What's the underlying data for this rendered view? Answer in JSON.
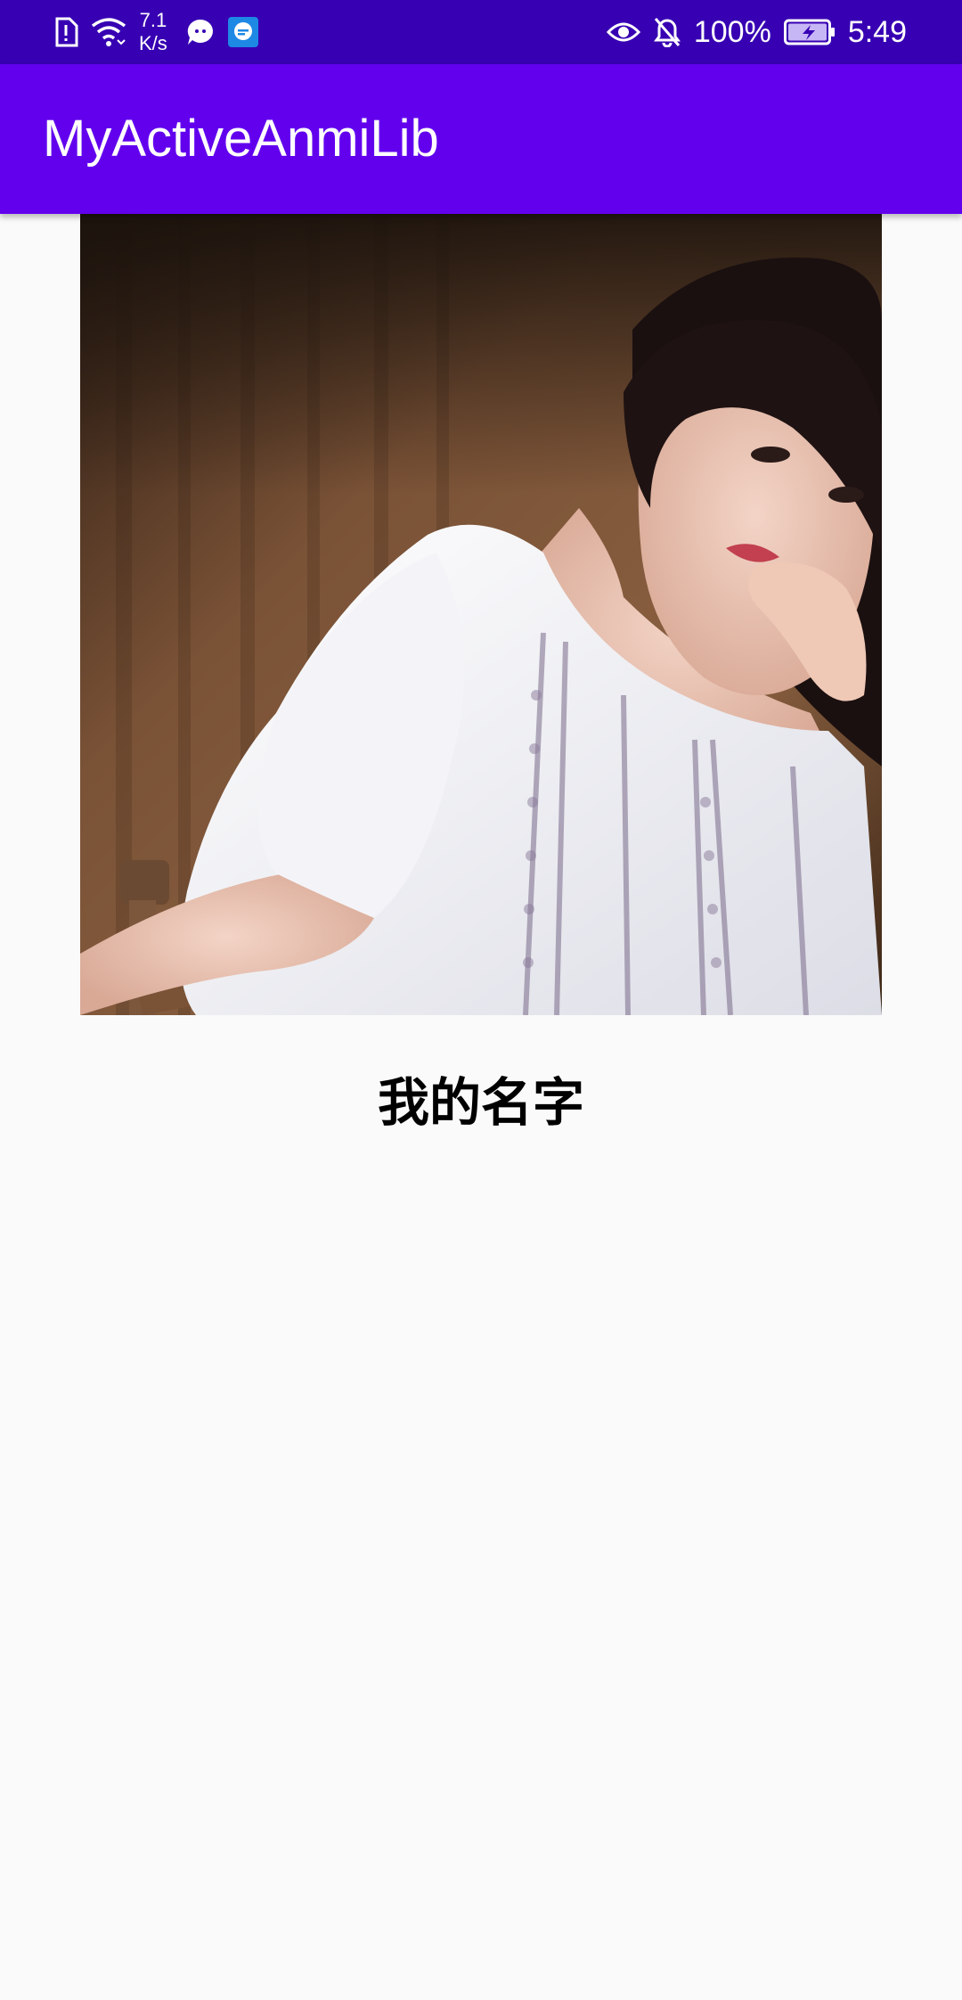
{
  "status_bar": {
    "net_speed_value": "7.1",
    "net_speed_unit": "K/s",
    "battery": "100%",
    "time": "5:49",
    "icons_left": [
      "sim-alert-icon",
      "wifi-icon",
      "chat-bubble-icon",
      "messenger-app-icon"
    ],
    "icons_right": [
      "eye-icon",
      "bell-muted-icon",
      "battery-charging-icon"
    ]
  },
  "app_bar": {
    "title": "MyActiveAnmiLib",
    "color": "#6200ee",
    "status_color": "#3700b3"
  },
  "content": {
    "photo_alt": "portrait-photo",
    "name": "我的名字"
  }
}
